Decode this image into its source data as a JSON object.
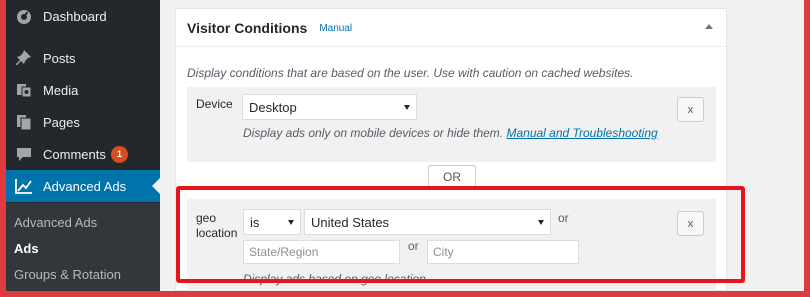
{
  "sidebar": {
    "menu": [
      {
        "label": "Dashboard",
        "icon": "dashboard-icon"
      },
      {
        "label": "Posts",
        "icon": "pin-icon"
      },
      {
        "label": "Media",
        "icon": "media-icon"
      },
      {
        "label": "Pages",
        "icon": "pages-icon"
      },
      {
        "label": "Comments",
        "icon": "comment-icon",
        "badge": "1"
      },
      {
        "label": "Advanced Ads",
        "icon": "chart-icon",
        "current": true
      }
    ],
    "submenu": [
      "Advanced Ads",
      "Ads",
      "Groups & Rotation"
    ]
  },
  "panel": {
    "title": "Visitor Conditions",
    "manual_link": "Manual",
    "description": "Display conditions that are based on the user. Use with caution on cached websites.",
    "conditions": {
      "device": {
        "label": "Device",
        "value": "Desktop",
        "help": "Display ads only on mobile devices or hide them.",
        "help_link": "Manual and Troubleshooting",
        "remove": "x"
      },
      "or_button": "OR",
      "geo": {
        "label": "geo location",
        "operator": "is",
        "country": "United States",
        "or_1": "or",
        "state_placeholder": "State/Region",
        "or_2": "or",
        "city_placeholder": "City",
        "help": "Display ads based on geo location.",
        "remove": "x"
      }
    }
  },
  "colors": {
    "admin_bar": "#23282d",
    "accent": "#0073aa",
    "highlight": "#e8141b",
    "badge": "#d54e21"
  }
}
